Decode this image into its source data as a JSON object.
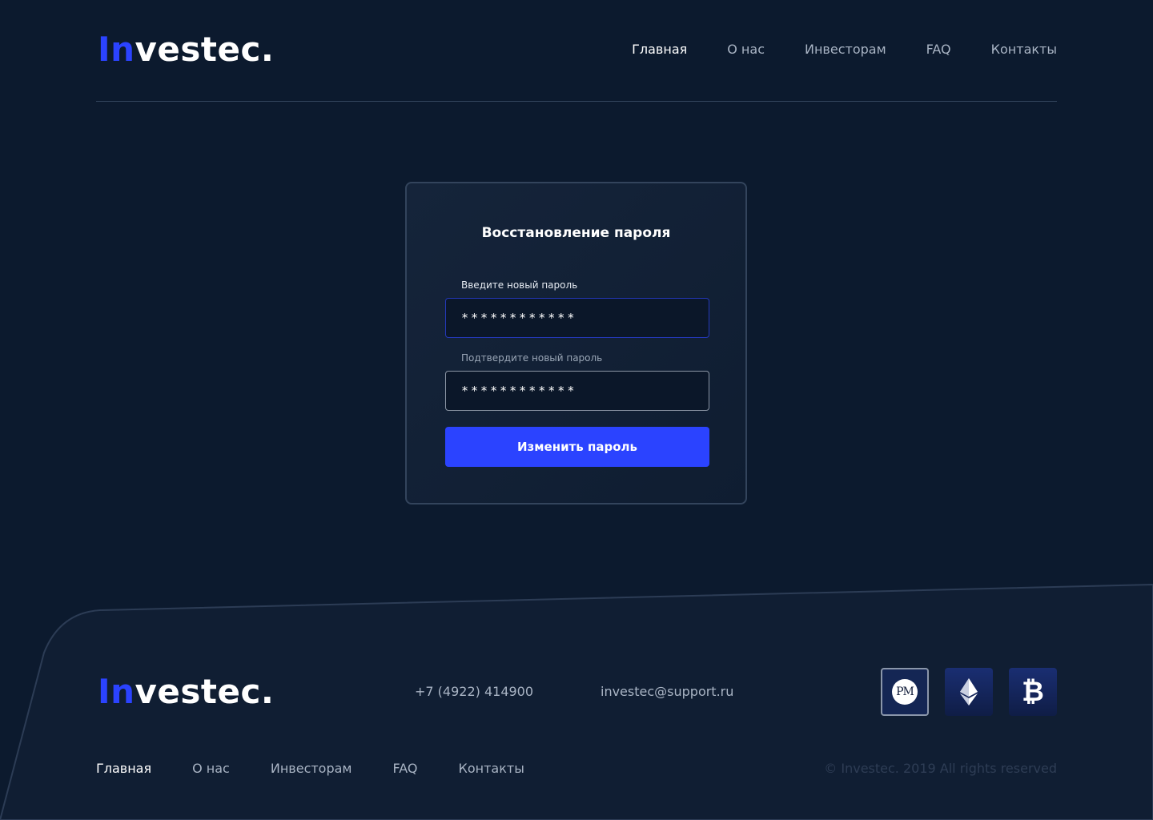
{
  "brand": {
    "logo_accent": "In",
    "logo_rest": "vestec.",
    "accent_color": "#2b43ff"
  },
  "header": {
    "nav": [
      {
        "label": "Главная",
        "active": true
      },
      {
        "label": "О нас"
      },
      {
        "label": "Инвесторам"
      },
      {
        "label": "FAQ"
      },
      {
        "label": "Контакты"
      }
    ]
  },
  "form": {
    "title": "Восстановление пароля",
    "new_password_label": "Введите новый пароль",
    "new_password_value": "************",
    "confirm_password_label": "Подтвердите новый пароль",
    "confirm_password_value": "************",
    "submit_label": "Изменить пароль"
  },
  "footer": {
    "phone": "+7 (4922) 414900",
    "email": "investec@support.ru",
    "payments": [
      {
        "name": "perfect-money",
        "label": "PM"
      },
      {
        "name": "ethereum"
      },
      {
        "name": "bitcoin",
        "glyph": "₿"
      }
    ],
    "nav": [
      {
        "label": "Главная",
        "active": true
      },
      {
        "label": "О нас"
      },
      {
        "label": "Инвесторам"
      },
      {
        "label": "FAQ"
      },
      {
        "label": "Контакты"
      }
    ],
    "copyright": "© Investec. 2019 All rights reserved"
  }
}
